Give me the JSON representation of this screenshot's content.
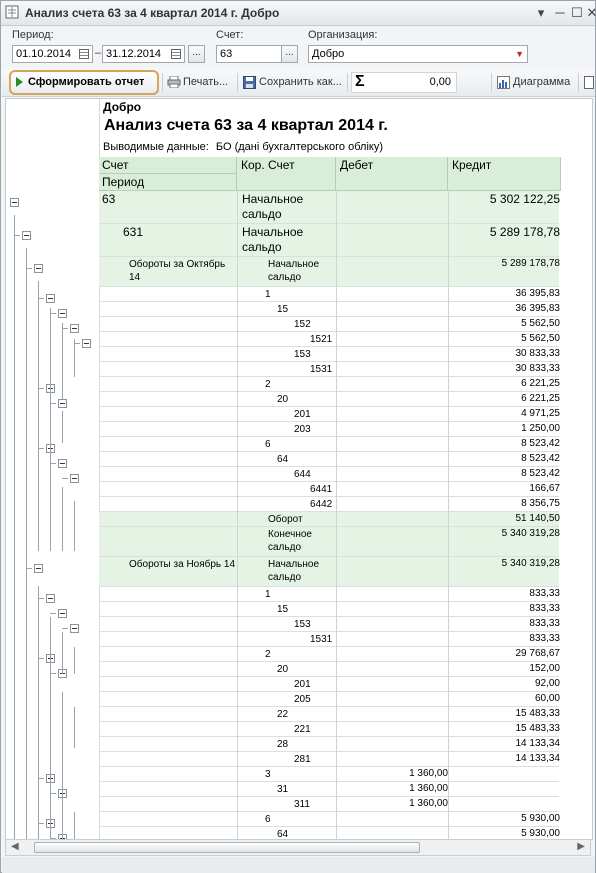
{
  "window": {
    "title": "Анализ счета 63 за 4 квартал 2014 г. Добро"
  },
  "filters": {
    "period_label": "Период:",
    "date_from": "01.10.2014",
    "date_sep": "–",
    "date_to": "31.12.2014",
    "ellipsis": "...",
    "account_label": "Счет:",
    "account_value": "63",
    "org_label": "Организация:",
    "org_value": "Добро"
  },
  "toolbar": {
    "generate_label": "Сформировать отчет",
    "print_label": "Печать...",
    "save_label": "Сохранить как...",
    "sum_symbol": "Σ",
    "sum_value": "0,00",
    "chart_label": "Диаграмма"
  },
  "report": {
    "org": "Добро",
    "title": "Анализ счета 63 за 4 квартал 2014 г.",
    "output_label": "Выводимые данные:",
    "output_value": "БО (дані бухгалтерського обліку)",
    "headers": {
      "account": "Счет",
      "period": "Период",
      "corr": "Кор. Счет",
      "debit": "Дебет",
      "credit": "Кредит"
    }
  },
  "rows": [
    {
      "a": "63",
      "c": "Начальное сальдо",
      "d": "",
      "k": "5 302 122,25"
    },
    {
      "a": "631",
      "c": "Начальное сальдо",
      "d": "",
      "k": "5 289 178,78"
    },
    {
      "a": "Обороты за Октябрь 14",
      "c": "Начальное сальдо",
      "d": "",
      "k": "5 289 178,78"
    },
    {
      "a": "",
      "c": "1",
      "d": "",
      "k": "36 395,83"
    },
    {
      "a": "",
      "c": "15",
      "d": "",
      "k": "36 395,83"
    },
    {
      "a": "",
      "c": "152",
      "d": "",
      "k": "5 562,50"
    },
    {
      "a": "",
      "c": "1521",
      "d": "",
      "k": "5 562,50"
    },
    {
      "a": "",
      "c": "153",
      "d": "",
      "k": "30 833,33"
    },
    {
      "a": "",
      "c": "1531",
      "d": "",
      "k": "30 833,33"
    },
    {
      "a": "",
      "c": "2",
      "d": "",
      "k": "6 221,25"
    },
    {
      "a": "",
      "c": "20",
      "d": "",
      "k": "6 221,25"
    },
    {
      "a": "",
      "c": "201",
      "d": "",
      "k": "4 971,25"
    },
    {
      "a": "",
      "c": "203",
      "d": "",
      "k": "1 250,00"
    },
    {
      "a": "",
      "c": "6",
      "d": "",
      "k": "8 523,42"
    },
    {
      "a": "",
      "c": "64",
      "d": "",
      "k": "8 523,42"
    },
    {
      "a": "",
      "c": "644",
      "d": "",
      "k": "8 523,42"
    },
    {
      "a": "",
      "c": "6441",
      "d": "",
      "k": "166,67"
    },
    {
      "a": "",
      "c": "6442",
      "d": "",
      "k": "8 356,75"
    },
    {
      "a": "",
      "c": "Оборот",
      "d": "",
      "k": "51 140,50"
    },
    {
      "a": "",
      "c": "Конечное сальдо",
      "d": "",
      "k": "5 340 319,28"
    },
    {
      "a": "Обороты за Ноябрь 14",
      "c": "Начальное сальдо",
      "d": "",
      "k": "5 340 319,28"
    },
    {
      "a": "",
      "c": "1",
      "d": "",
      "k": "833,33"
    },
    {
      "a": "",
      "c": "15",
      "d": "",
      "k": "833,33"
    },
    {
      "a": "",
      "c": "153",
      "d": "",
      "k": "833,33"
    },
    {
      "a": "",
      "c": "1531",
      "d": "",
      "k": "833,33"
    },
    {
      "a": "",
      "c": "2",
      "d": "",
      "k": "29 768,67"
    },
    {
      "a": "",
      "c": "20",
      "d": "",
      "k": "152,00"
    },
    {
      "a": "",
      "c": "201",
      "d": "",
      "k": "92,00"
    },
    {
      "a": "",
      "c": "205",
      "d": "",
      "k": "60,00"
    },
    {
      "a": "",
      "c": "22",
      "d": "",
      "k": "15 483,33"
    },
    {
      "a": "",
      "c": "221",
      "d": "",
      "k": "15 483,33"
    },
    {
      "a": "",
      "c": "28",
      "d": "",
      "k": "14 133,34"
    },
    {
      "a": "",
      "c": "281",
      "d": "",
      "k": "14 133,34"
    },
    {
      "a": "",
      "c": "3",
      "d": "1 360,00",
      "k": ""
    },
    {
      "a": "",
      "c": "31",
      "d": "1 360,00",
      "k": ""
    },
    {
      "a": "",
      "c": "311",
      "d": "1 360,00",
      "k": ""
    },
    {
      "a": "",
      "c": "6",
      "d": "",
      "k": "5 930,00"
    },
    {
      "a": "",
      "c": "64",
      "d": "",
      "k": "5 930,00"
    }
  ]
}
